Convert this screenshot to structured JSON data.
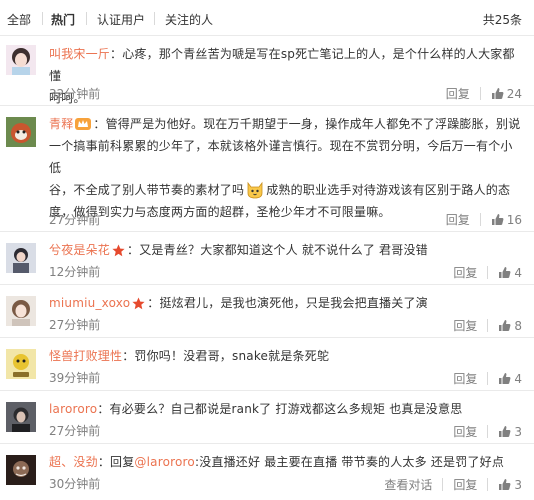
{
  "filters": {
    "all": "全部",
    "hot": "热门",
    "verified": "认证用户",
    "following": "关注的人",
    "total": "共25条"
  },
  "comments": [
    {
      "user": "叫我宋一斤",
      "text_before": "：心疼，那个青丝苦为嗁是写在sp死亡笔记上的人，是个什么样的人大家都懂",
      "text_after": "呵呵。",
      "time": "32分钟前",
      "reply": "回复",
      "likes": "24"
    },
    {
      "user": "青释",
      "text_a": "：管得严是为他好。现在万千期望于一身，操作成年人都免不了浮躁膨胀，别说",
      "text_b": "一个搞事前科累累的少年了，本就该格外谨言慎行。现在不赏罚分明，今后万一有个小低",
      "text_c": "谷，不全成了别人带节奏的素材了吗",
      "text_d": "成熟的职业选手对待游戏该有区别于路人的态",
      "text_e": "度，做得到实力与态度两方面的超群，圣枪少年才不可限量嘛。",
      "time": "27分钟前",
      "reply": "回复",
      "likes": "16"
    },
    {
      "user": "兮夜是朵花",
      "text": "：又是青丝？大家都知道这个人 就不说什么了 君哥没错",
      "time": "12分钟前",
      "reply": "回复",
      "likes": "4"
    },
    {
      "user": "miumiu_xoxo",
      "text": "：挺炫君儿，是我也演死他，只是我会把直播关了演",
      "time": "27分钟前",
      "reply": "回复",
      "likes": "8"
    },
    {
      "user": "怪兽打败理性",
      "text": "：罚你吗！没君哥，snake就是条死鸵",
      "time": "39分钟前",
      "reply": "回复",
      "likes": "4"
    },
    {
      "user": "larororo",
      "text": "：有必要么？自己都说是rank了 打游戏都这么多规矩 也真是没意思",
      "time": "27分钟前",
      "reply": "回复",
      "likes": "3"
    },
    {
      "user": "超、没劲",
      "text_pre": "：回复",
      "mention": "@larororo",
      "text_post": ":没直播还好 最主要在直播 带节奏的人太多 还是罚了好点",
      "time": "30分钟前",
      "view_conversation": "查看对话",
      "reply": "回复",
      "likes": "3"
    }
  ],
  "colors": {
    "accent": "#eb7350",
    "meta": "#808080",
    "divider": "#eaeaea",
    "vip_badge": "#f7a23b",
    "star_badge": "#e64a2e"
  },
  "icons": {
    "like": "thumbs-up-icon",
    "badge_vip": "crown-badge-icon",
    "badge_star": "red-star-icon",
    "emoji": "cat-face-emoji-icon"
  }
}
